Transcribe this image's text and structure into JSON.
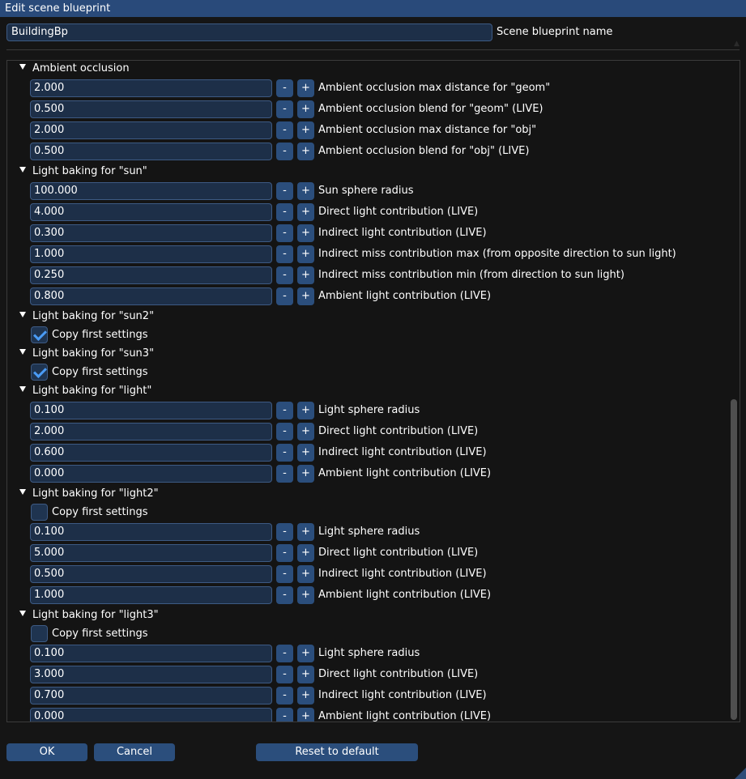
{
  "window": {
    "title": "Edit scene blueprint"
  },
  "name_field": {
    "value": "BuildingBp",
    "label": "Scene blueprint name"
  },
  "sections": [
    {
      "title": "Ambient occlusion",
      "rows": [
        {
          "value": "2.000",
          "label": "Ambient occlusion max distance for \"geom\""
        },
        {
          "value": "0.500",
          "label": "Ambient occlusion blend for \"geom\" (LIVE)"
        },
        {
          "value": "2.000",
          "label": "Ambient occlusion max distance for \"obj\""
        },
        {
          "value": "0.500",
          "label": "Ambient occlusion blend for \"obj\" (LIVE)"
        }
      ]
    },
    {
      "title": "Light baking for \"sun\"",
      "rows": [
        {
          "value": "100.000",
          "label": "Sun sphere radius"
        },
        {
          "value": "4.000",
          "label": "Direct light contribution (LIVE)"
        },
        {
          "value": "0.300",
          "label": "Indirect light contribution (LIVE)"
        },
        {
          "value": "1.000",
          "label": "Indirect miss contribution max (from opposite direction to sun light)"
        },
        {
          "value": "0.250",
          "label": "Indirect miss contribution min (from direction to sun light)"
        },
        {
          "value": "0.800",
          "label": "Ambient light contribution (LIVE)"
        }
      ]
    },
    {
      "title": "Light baking for \"sun2\"",
      "copy_first": {
        "checked": true,
        "label": "Copy first settings"
      }
    },
    {
      "title": "Light baking for \"sun3\"",
      "copy_first": {
        "checked": true,
        "label": "Copy first settings"
      }
    },
    {
      "title": "Light baking for \"light\"",
      "rows": [
        {
          "value": "0.100",
          "label": "Light sphere radius"
        },
        {
          "value": "2.000",
          "label": "Direct light contribution (LIVE)"
        },
        {
          "value": "0.600",
          "label": "Indirect light contribution (LIVE)"
        },
        {
          "value": "0.000",
          "label": "Ambient light contribution (LIVE)"
        }
      ]
    },
    {
      "title": "Light baking for \"light2\"",
      "copy_first": {
        "checked": false,
        "label": "Copy first settings"
      },
      "rows": [
        {
          "value": "0.100",
          "label": "Light sphere radius"
        },
        {
          "value": "5.000",
          "label": "Direct light contribution (LIVE)"
        },
        {
          "value": "0.500",
          "label": "Indirect light contribution (LIVE)"
        },
        {
          "value": "1.000",
          "label": "Ambient light contribution (LIVE)"
        }
      ]
    },
    {
      "title": "Light baking for \"light3\"",
      "copy_first": {
        "checked": false,
        "label": "Copy first settings"
      },
      "rows": [
        {
          "value": "0.100",
          "label": "Light sphere radius"
        },
        {
          "value": "3.000",
          "label": "Direct light contribution (LIVE)"
        },
        {
          "value": "0.700",
          "label": "Indirect light contribution (LIVE)"
        },
        {
          "value": "0.000",
          "label": "Ambient light contribution (LIVE)"
        }
      ]
    }
  ],
  "stepper": {
    "minus": "-",
    "plus": "+"
  },
  "footer": {
    "ok": "OK",
    "cancel": "Cancel",
    "reset": "Reset to default"
  },
  "colors": {
    "title_bar": "#294a7a",
    "button": "#2b4e7c",
    "field_bg": "#1d2f48",
    "check": "#4a9bf5"
  }
}
